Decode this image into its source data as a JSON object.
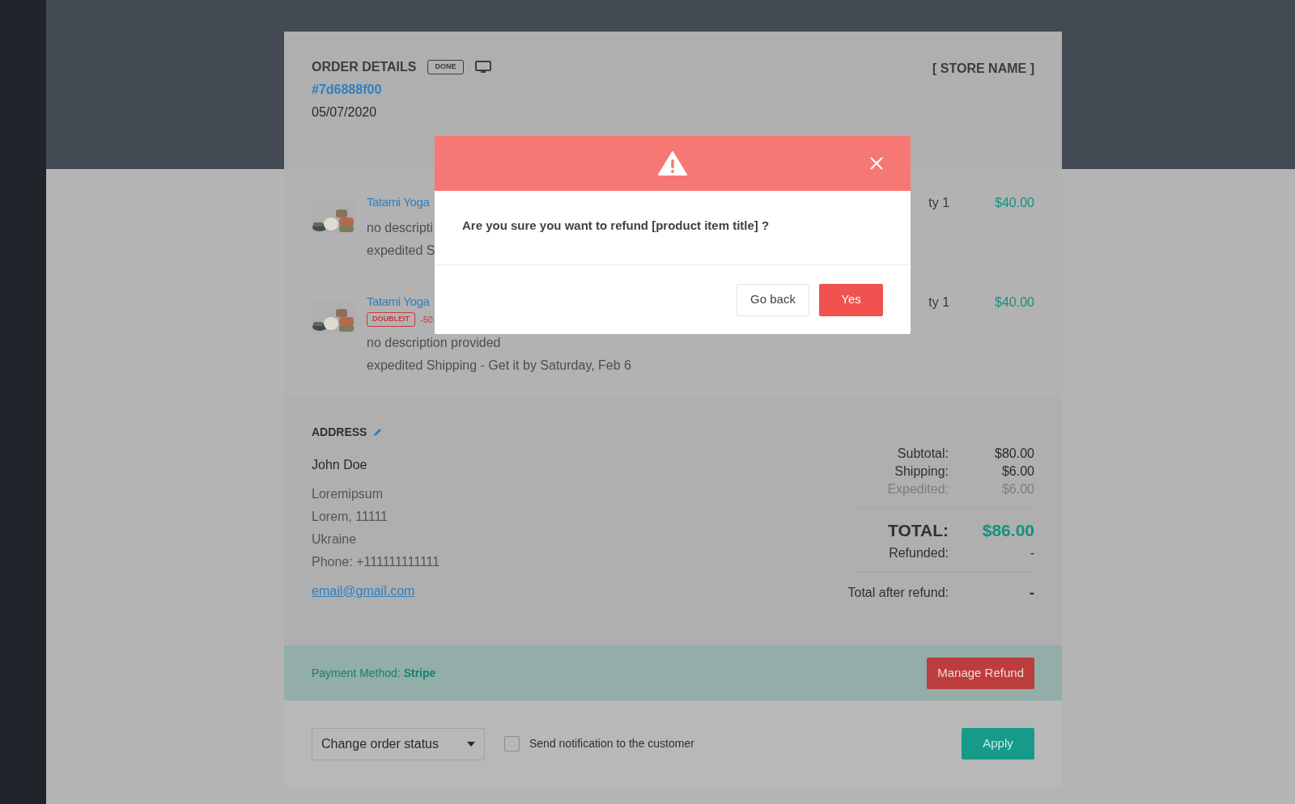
{
  "order": {
    "title": "ORDER DETAILS",
    "status_badge": "DONE",
    "order_id": "#7d6888f00",
    "date": "05/07/2020",
    "store_name": "[ STORE NAME ]"
  },
  "items": [
    {
      "title": "Tatami Yoga",
      "description": "no descripti",
      "shipping": "expedited S",
      "qty": "ty 1",
      "price": "$40.00"
    },
    {
      "title": "Tatami Yoga",
      "badge": "DOUBLEIT",
      "discount": "-50",
      "description": "no description provided",
      "shipping": "expedited Shipping - Get it by Saturday, Feb 6",
      "qty": "ty 1",
      "price": "$40.00"
    }
  ],
  "address": {
    "heading": "ADDRESS",
    "name": "John Doe",
    "lines": [
      "Loremipsum",
      "Lorem, 11111",
      "Ukraine",
      "Phone: +111111111111"
    ],
    "email": "email@gmail.com"
  },
  "summary": [
    {
      "kind": "normal",
      "label": "Subtotal:",
      "value": "$80.00"
    },
    {
      "kind": "normal",
      "label": "Shipping:",
      "value": "$6.00"
    },
    {
      "kind": "muted",
      "label": "Expedited:",
      "value": "$6.00"
    },
    {
      "kind": "total",
      "label": "TOTAL:",
      "value": "$86.00"
    },
    {
      "kind": "normal",
      "label": "Refunded:",
      "value": "-"
    },
    {
      "kind": "final",
      "label": "Total after refund:",
      "value": "-"
    }
  ],
  "payment": {
    "label": "Payment Method:",
    "method": "Stripe",
    "button": "Manage Refund"
  },
  "footer": {
    "status_select": "Change order status",
    "notify": {
      "label": "Send notification to the customer",
      "checked": false
    },
    "apply": "Apply"
  },
  "modal": {
    "message": "Are you sure you want to refund [product item title] ?",
    "buttons": [
      {
        "label": "Go back",
        "kind": "secondary"
      },
      {
        "label": "Yes",
        "kind": "primary"
      }
    ]
  }
}
